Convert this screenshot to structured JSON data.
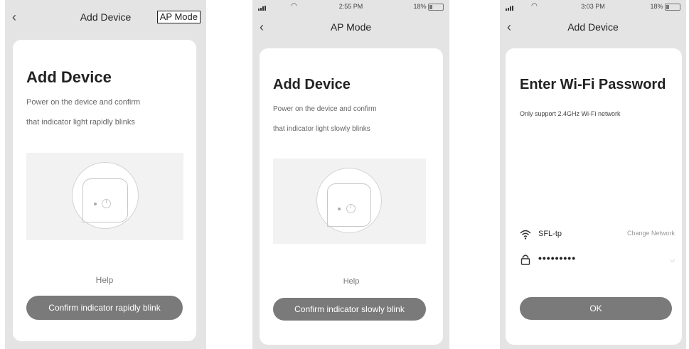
{
  "screen1": {
    "nav_title": "Add Device",
    "ap_mode_button": "AP Mode",
    "heading": "Add Device",
    "desc_line1": "Power on the device and confirm",
    "desc_line2": "that indicator light rapidly blinks",
    "help": "Help",
    "confirm_button": "Confirm indicator rapidly blink"
  },
  "screen2": {
    "time": "2:55 PM",
    "battery": "18%",
    "nav_title": "AP Mode",
    "heading": "Add Device",
    "desc_line1": "Power on the device and confirm",
    "desc_line2": "that indicator light slowly blinks",
    "help": "Help",
    "confirm_button": "Confirm indicator slowly blink"
  },
  "screen3": {
    "time": "3:03 PM",
    "battery": "18%",
    "nav_title": "Add Device",
    "heading": "Enter Wi-Fi Password",
    "subtitle": "Only support 2.4GHz Wi-Fi network",
    "network_name": "SFL-tp",
    "change_network": "Change Network",
    "password_masked": "•••••••••",
    "ok_button": "OK"
  },
  "icons": [
    "back-chevron-icon",
    "power-icon",
    "wifi-icon",
    "lock-icon",
    "signal-icon",
    "battery-icon"
  ],
  "colors": {
    "background": "#e4e4e4",
    "card": "#ffffff",
    "button": "#7a7a7a",
    "illustration": "#f2f2f2"
  }
}
